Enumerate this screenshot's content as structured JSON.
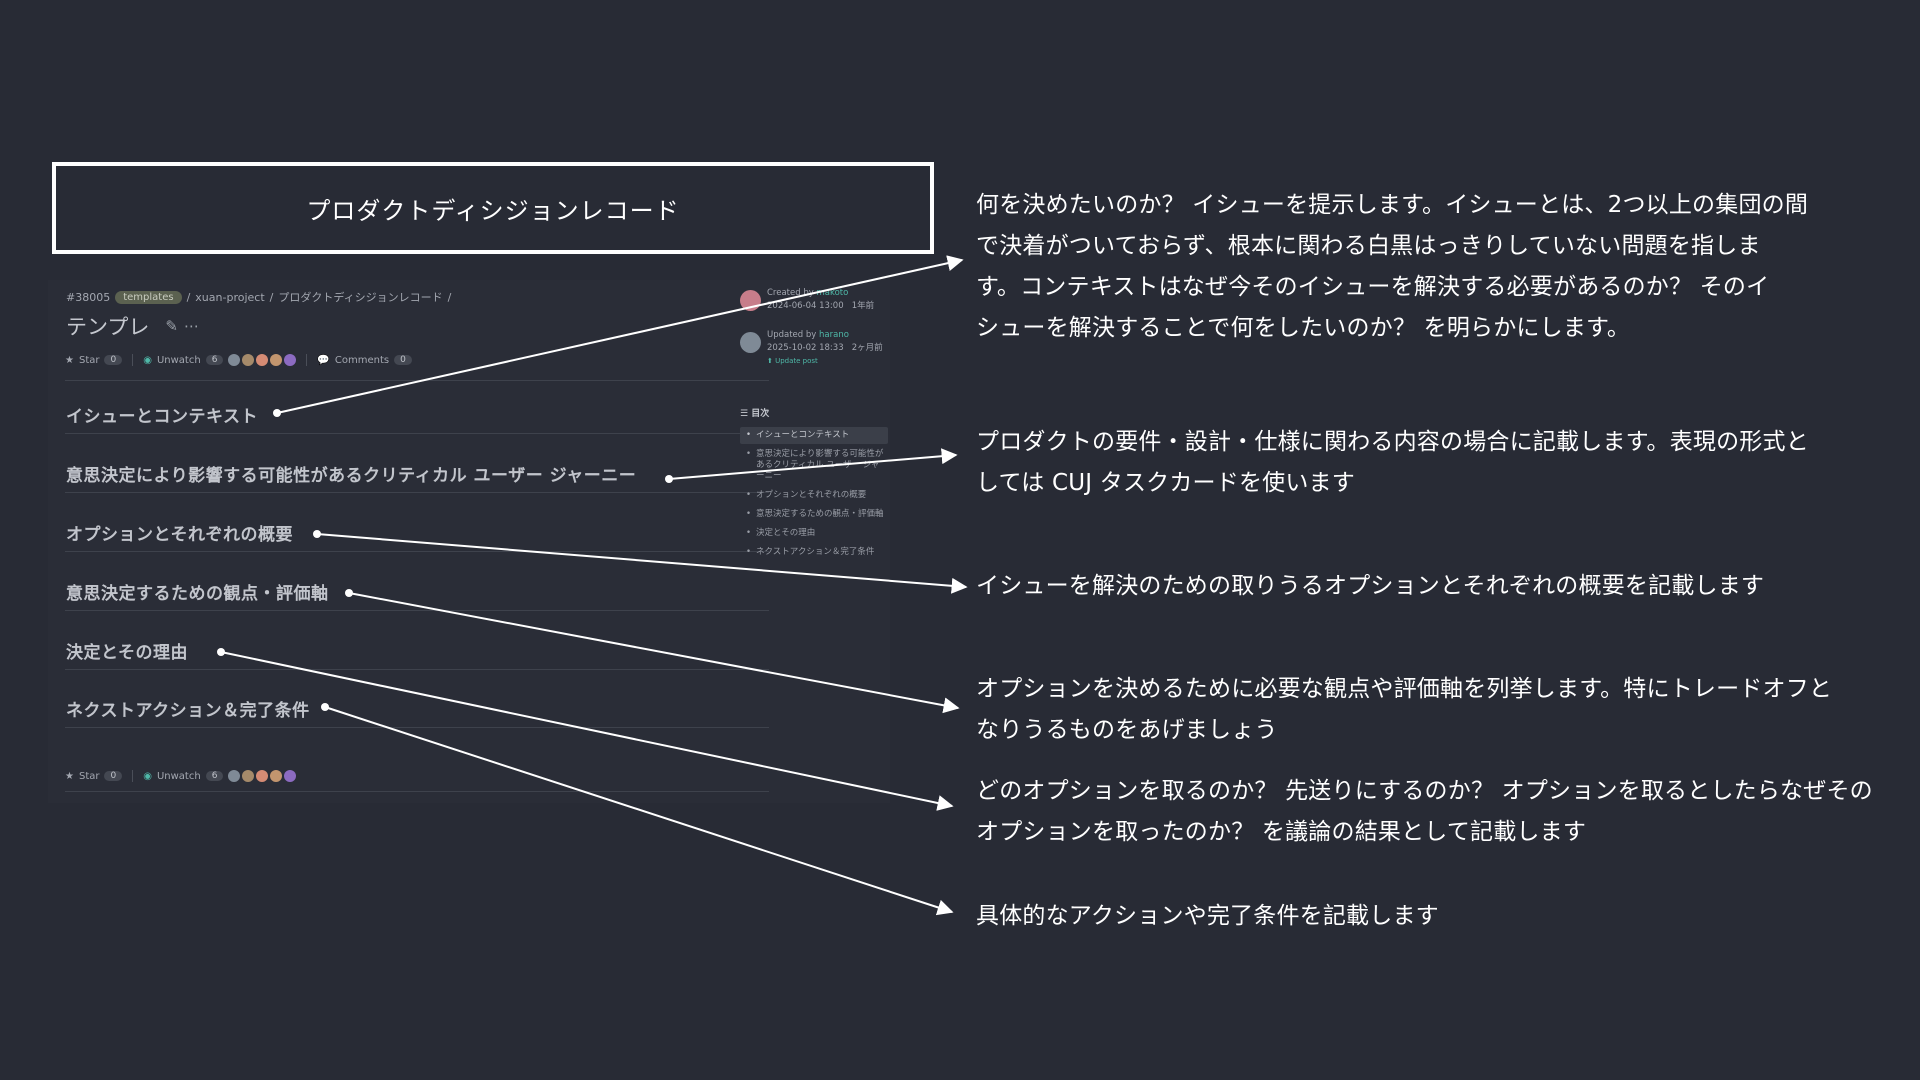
{
  "title": "プロダクトディシジョンレコード",
  "screenshot": {
    "breadcrumb": {
      "id": "#38005",
      "tag": "templates",
      "sep": "/",
      "project": "xuan-project",
      "page": "プロダクトディシジョンレコード"
    },
    "doc_title": "テンプレ",
    "edit_icon": "✎",
    "more_icon": "⋯",
    "meta": {
      "star_label": "Star",
      "star_count": "0",
      "unwatch_label": "Unwatch",
      "unwatch_count": "6",
      "comments_label": "Comments",
      "comments_count": "0"
    },
    "created": {
      "label": "Created by",
      "user": "makoto",
      "date": "2024-06-04 13:00",
      "ago": "1年前"
    },
    "updated": {
      "label": "Updated by",
      "user": "harano",
      "date": "2025-10-02 18:33",
      "ago": "2ヶ月前",
      "update_post": "Update post"
    },
    "toc_icon": "☰",
    "toc_title": "目次",
    "toc": [
      "イシューとコンテキスト",
      "意思決定により影響する可能性があるクリティカル ユーザー ジャーニー",
      "オプションとそれぞれの概要",
      "意思決定するための観点・評価軸",
      "決定とその理由",
      "ネクストアクション＆完了条件"
    ],
    "sections": [
      "イシューとコンテキスト",
      "意思決定により影響する可能性があるクリティカル ユーザー ジャーニー",
      "オプションとそれぞれの概要",
      "意思決定するための観点・評価軸",
      "決定とその理由",
      "ネクストアクション＆完了条件"
    ]
  },
  "descriptions": [
    [
      "何を決めたいのか？ イシューを提示します。イシューとは、2つ以上の集団の間",
      "で決着がついておらず、根本に関わる白黒はっきりしていない問題を指しま",
      "す。コンテキストはなぜ今そのイシューを解決する必要があるのか？ そのイ",
      "シューを解決することで何をしたいのか？ を明らかにします。"
    ],
    [
      "プロダクトの要件・設計・仕様に関わる内容の場合に記載します。表現の形式と",
      "しては CUJ タスクカードを使います"
    ],
    [
      "イシューを解決のための取りうるオプションとそれぞれの概要を記載します"
    ],
    [
      "オプションを決めるために必要な観点や評価軸を列挙します。特にトレードオフと",
      "なりうるものをあげましょう"
    ],
    [
      "どのオプションを取るのか？ 先送りにするのか？ オプションを取るとしたらなぜその",
      "オプションを取ったのか？ を議論の結果として記載します"
    ],
    [
      "具体的なアクションや完了条件を記載します"
    ]
  ],
  "colors": {
    "background": "#282b35",
    "accent": "#4fb8a8",
    "line": "#ffffff"
  }
}
